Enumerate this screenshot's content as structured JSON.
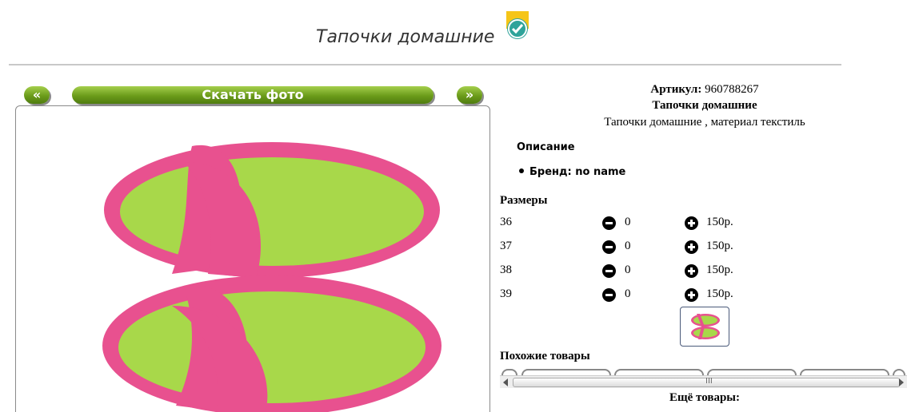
{
  "page": {
    "title": "Тапочки домашние"
  },
  "gallery": {
    "prev_label": "«",
    "download_label": "Скачать фото",
    "next_label": "»"
  },
  "product": {
    "article_label": "Артикул:",
    "article_value": "960788267",
    "name": "Тапочки домашние",
    "description": "Тапочки домашние , материал текстиль",
    "description_heading": "Описание",
    "brand_line": "Бренд: no name"
  },
  "sizes": {
    "heading": "Размеры",
    "rows": [
      {
        "size": "36",
        "qty": "0",
        "price": "150р."
      },
      {
        "size": "37",
        "qty": "0",
        "price": "150р."
      },
      {
        "size": "38",
        "qty": "0",
        "price": "150р."
      },
      {
        "size": "39",
        "qty": "0",
        "price": "150р."
      }
    ]
  },
  "similar": {
    "heading": "Похожие товары",
    "scroll_grip": "III"
  },
  "more": {
    "heading": "Ещё товары:"
  },
  "colors": {
    "accent_green": "#6b9b1a",
    "badge_yellow": "#f5c518",
    "badge_teal": "#2ea39a",
    "slipper_pink": "#e8518f",
    "slipper_green": "#a8d84a"
  }
}
